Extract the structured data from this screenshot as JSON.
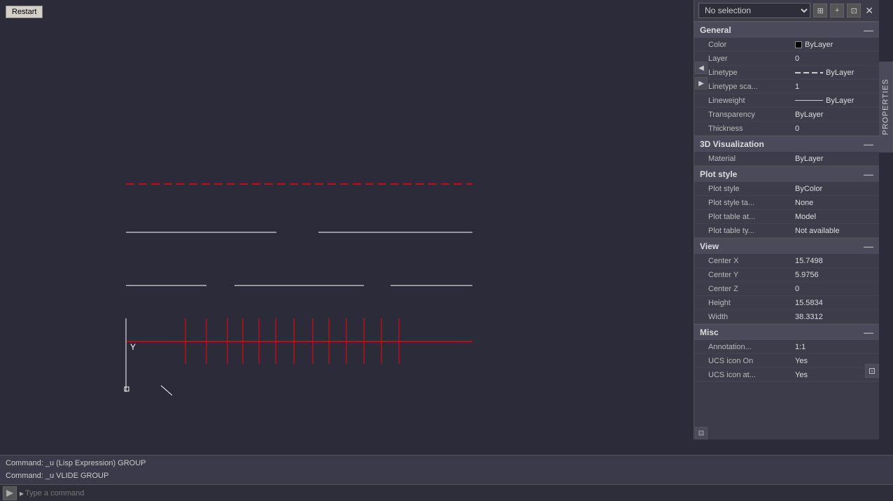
{
  "restart_button": "Restart",
  "panel": {
    "title": "Properties",
    "selection": "No selection",
    "close_icon": "✕",
    "collapse_icon": "◀",
    "expand_icon": "▶",
    "icons": {
      "toggle1": "⊞",
      "toggle2": "+",
      "toggle3": "⊡"
    }
  },
  "sections": {
    "general": {
      "label": "General",
      "properties": [
        {
          "label": "Color",
          "value": "ByLayer",
          "type": "color"
        },
        {
          "label": "Layer",
          "value": "0"
        },
        {
          "label": "Linetype",
          "value": "ByLayer",
          "type": "linetype"
        },
        {
          "label": "Linetype sca...",
          "value": "1"
        },
        {
          "label": "Lineweight",
          "value": "ByLayer",
          "type": "lineweight"
        },
        {
          "label": "Transparency",
          "value": "ByLayer"
        },
        {
          "label": "Thickness",
          "value": "0"
        }
      ]
    },
    "visualization_3d": {
      "label": "3D Visualization",
      "properties": [
        {
          "label": "Material",
          "value": "ByLayer"
        }
      ]
    },
    "plot_style": {
      "label": "Plot style",
      "properties": [
        {
          "label": "Plot style",
          "value": "ByColor"
        },
        {
          "label": "Plot style ta...",
          "value": "None"
        },
        {
          "label": "Plot table at...",
          "value": "Model"
        },
        {
          "label": "Plot table ty...",
          "value": "Not available"
        }
      ]
    },
    "view": {
      "label": "View",
      "properties": [
        {
          "label": "Center X",
          "value": "15.7498"
        },
        {
          "label": "Center Y",
          "value": "5.9756"
        },
        {
          "label": "Center Z",
          "value": "0"
        },
        {
          "label": "Height",
          "value": "15.5834"
        },
        {
          "label": "Width",
          "value": "38.3312"
        }
      ]
    },
    "misc": {
      "label": "Misc",
      "properties": [
        {
          "label": "Annotation...",
          "value": "1:1"
        },
        {
          "label": "UCS icon On",
          "value": "Yes"
        },
        {
          "label": "UCS icon at...",
          "value": "Yes"
        }
      ]
    }
  },
  "commands": [
    "Command:  _u (Lisp Expression) GROUP",
    "Command:  _u VLIDE GROUP"
  ],
  "command_input": {
    "placeholder": "Type a command"
  },
  "properties_tab": "PROPERTIES"
}
